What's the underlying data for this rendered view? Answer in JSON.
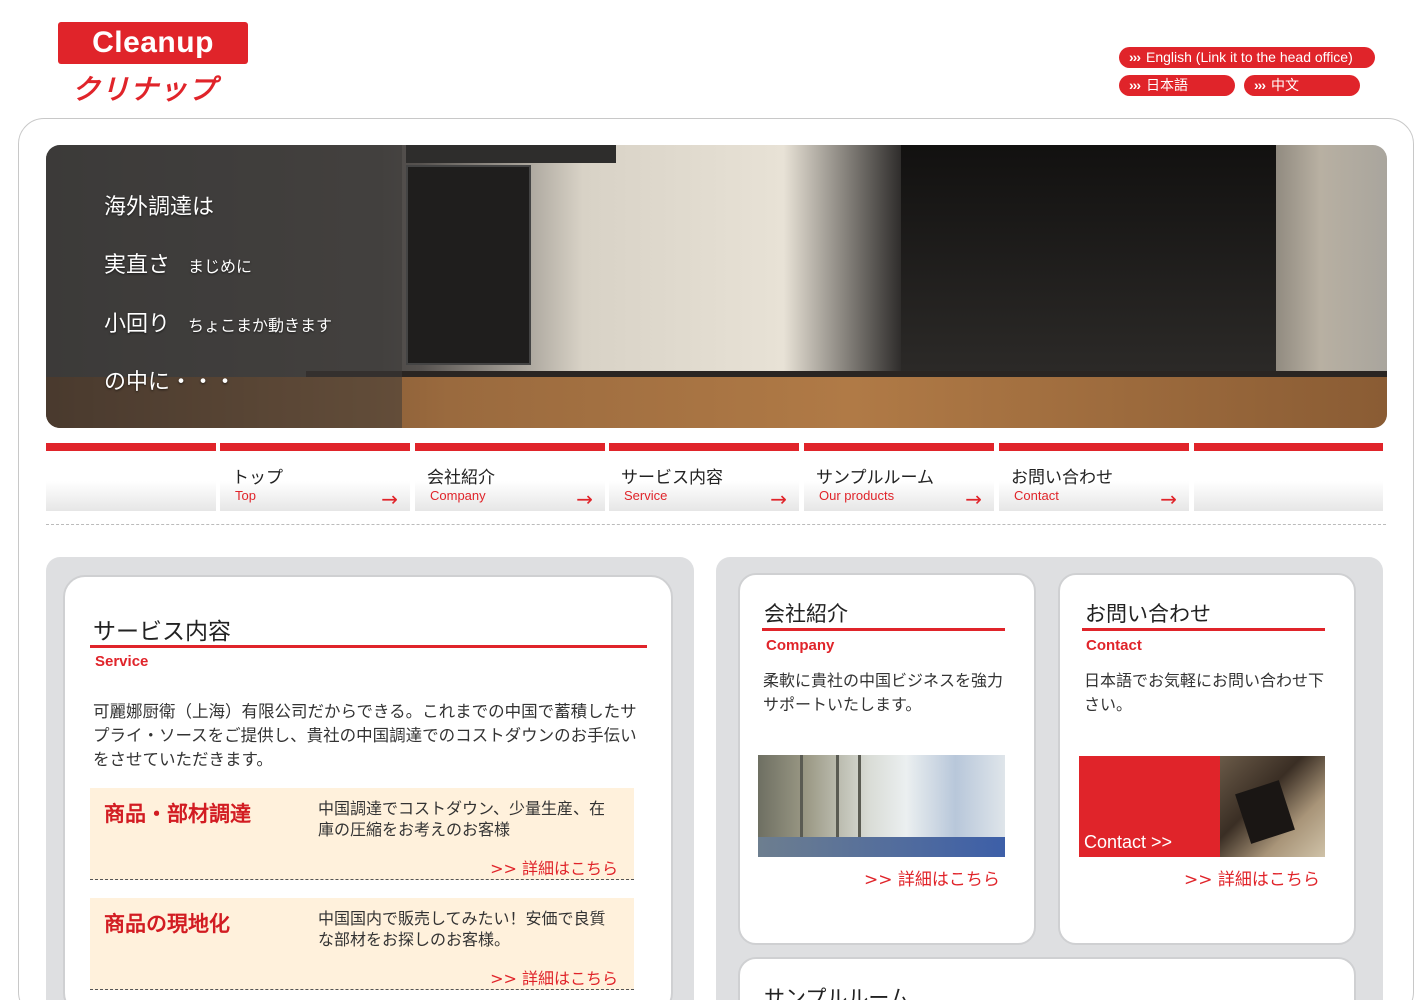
{
  "header": {
    "logo_text": "Cleanup",
    "logo_kana": "クリナップ",
    "lang_english": "English (Link it to the head office)",
    "lang_japanese": "日本語",
    "lang_chinese": "中文",
    "lang_arrow": "›››"
  },
  "hero": {
    "line1": "海外調達は",
    "line2": "実直さ",
    "line2_sub": "まじめに",
    "line3": "小回り",
    "line3_sub": "ちょこまか動きます",
    "line4": "の中に・・・"
  },
  "nav": {
    "arrow": "→",
    "items": [
      {
        "ja": "トップ",
        "en": "Top"
      },
      {
        "ja": "会社紹介",
        "en": "Company"
      },
      {
        "ja": "サービス内容",
        "en": "Service"
      },
      {
        "ja": "サンプルルーム",
        "en": "Our products"
      },
      {
        "ja": "お問い合わせ",
        "en": "Contact"
      }
    ]
  },
  "service": {
    "title": "サービス内容",
    "subtitle": "Service",
    "intro": "可麗娜厨衛（上海）有限公司だからできる。これまでの中国で蓄積したサプライ・ソースをご提供し、貴社の中国調達でのコストダウンのお手伝いをさせていただきます。",
    "boxes": [
      {
        "title": "商品・部材調達",
        "desc": "中国調達でコストダウン、少量生産、在庫の圧縮をお考えのお客様",
        "link": ">> 詳細はこちら"
      },
      {
        "title": "商品の現地化",
        "desc": "中国国内で販売してみたい！安価で良質な部材をお探しのお客様。",
        "link": ">> 詳細はこちら"
      }
    ]
  },
  "company": {
    "title": "会社紹介",
    "subtitle": "Company",
    "desc": "柔軟に貴社の中国ビジネスを強力サポートいたします。",
    "link": ">> 詳細はこちら"
  },
  "contact": {
    "title": "お問い合わせ",
    "subtitle": "Contact",
    "desc": "日本語でお気軽にお問い合わせ下さい。",
    "image_label": "Contact >>",
    "link": ">> 詳細はこちら"
  },
  "sample": {
    "title": "サンプルルーム"
  },
  "colors": {
    "brand_red": "#e0242a",
    "box_bg": "#fff1dc",
    "panel_gray": "#dedfe1"
  }
}
